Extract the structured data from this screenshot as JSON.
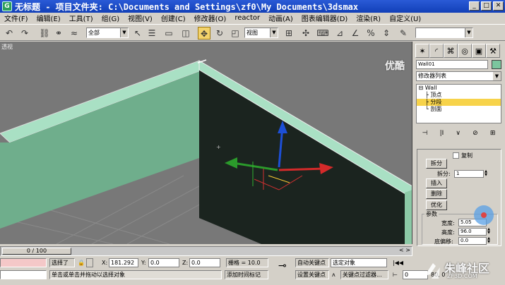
{
  "titlebar": {
    "title": "无标题   - 项目文件夹: C:\\Documents and Settings\\zf0\\My Documents\\3dsmax"
  },
  "menu": [
    "文件(F)",
    "编辑(E)",
    "工具(T)",
    "组(G)",
    "视图(V)",
    "创建(C)",
    "修改器(O)",
    "reactor",
    "动画(A)",
    "图表编辑器(D)",
    "渲染(R)",
    "自定义(U)"
  ],
  "toolbar": {
    "selection_filter": "全部",
    "reference_coord": "视图"
  },
  "viewport": {
    "label": "透视"
  },
  "command_panel": {
    "object_name": "Wall01",
    "object_color": "#7bc69e",
    "modifier_list": "修改器列表",
    "stack": {
      "root": "Wall",
      "items": [
        "顶点",
        "分段",
        "剖面"
      ],
      "selected_index": 1
    },
    "segment": {
      "copy_label": "复制",
      "break_button": "拆分",
      "divide_label": "拆分:",
      "divide_value": "1",
      "insert_button": "插入",
      "delete_button": "删除",
      "refine_button": "优化",
      "params_title": "参数",
      "width_label": "宽度:",
      "width_value": "5.05",
      "height_label": "高度:",
      "height_value": "96.0",
      "bottom_offset_label": "底偏移:",
      "bottom_offset_value": "0.0"
    }
  },
  "timeline": {
    "frame_display": "0 / 100"
  },
  "statusbar": {
    "selection_status": "选择了",
    "x_label": "X:",
    "x_value": "181.292",
    "y_label": "Y:",
    "y_value": "0.0",
    "z_label": "Z:",
    "z_value": "0.0",
    "grid_label": "栅格 = 10.0",
    "auto_key_label": "自动关键点",
    "auto_key_mode": "选定对象",
    "set_key_label": "设置关键点",
    "key_filter_label": "关键点过滤器...",
    "prompt": "单击或单击并拖动以选择对象",
    "add_time_tag": "添加时间标记",
    "frame_field": "0",
    "zoom_field": "80, 0"
  },
  "watermark": {
    "text": "朱峰社区",
    "url": "ZF3D.COM"
  },
  "corner_logo": "优酷"
}
